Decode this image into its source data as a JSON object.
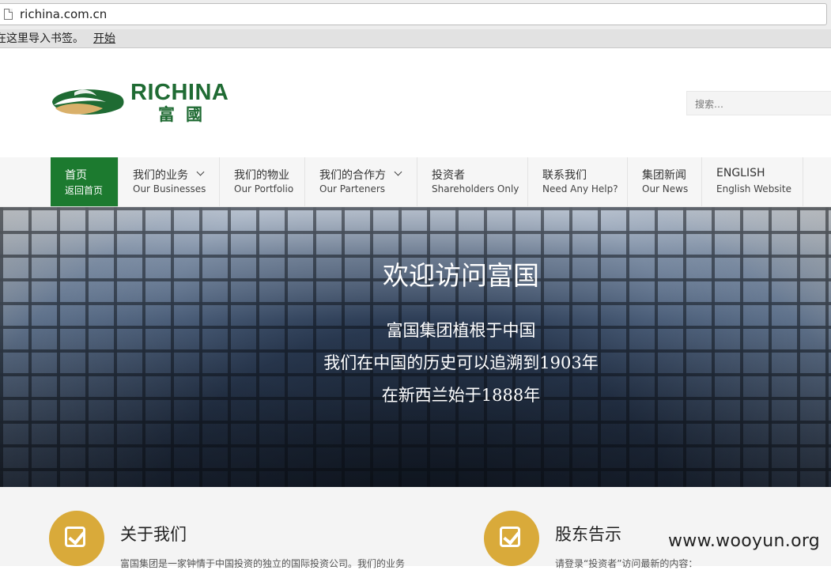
{
  "browser": {
    "url": "richina.com.cn",
    "bookmark_text": "在这里导入书签。",
    "bookmark_link": "开始"
  },
  "logo": {
    "en": "RICHINA",
    "cn": "富國",
    "colors": {
      "green": "#1f6b33",
      "gold": "#d9b06a"
    }
  },
  "search": {
    "placeholder": "搜索…"
  },
  "nav": [
    {
      "cn": "首页",
      "en": "返回首页",
      "active": true,
      "dropdown": false
    },
    {
      "cn": "我们的业务",
      "en": "Our Businesses",
      "active": false,
      "dropdown": true
    },
    {
      "cn": "我们的物业",
      "en": "Our Portfolio",
      "active": false,
      "dropdown": false
    },
    {
      "cn": "我们的合作方",
      "en": "Our Parteners",
      "active": false,
      "dropdown": true
    },
    {
      "cn": "投资者",
      "en": "Shareholders Only",
      "active": false,
      "dropdown": false
    },
    {
      "cn": "联系我们",
      "en": "Need Any Help?",
      "active": false,
      "dropdown": false
    },
    {
      "cn": "集团新闻",
      "en": "Our News",
      "active": false,
      "dropdown": false
    },
    {
      "cn": "ENGLISH",
      "en": "English Website",
      "active": false,
      "dropdown": false
    }
  ],
  "hero": {
    "title": "欢迎访问富国",
    "lines": [
      "富国集团植根于中国",
      "我们在中国的历史可以追溯到1903年",
      "在新西兰始于1888年"
    ]
  },
  "sections": [
    {
      "title": "关于我们",
      "text": "富国集团是一家钟情于中国投资的独立的国际投资公司。我们的业务"
    },
    {
      "title": "股东告示",
      "text": "请登录“投资者”访问最新的内容："
    }
  ],
  "watermark": "www.wooyun.org",
  "colors": {
    "nav_active": "#1c7a2f",
    "icon_circle": "#d9aa3a"
  }
}
